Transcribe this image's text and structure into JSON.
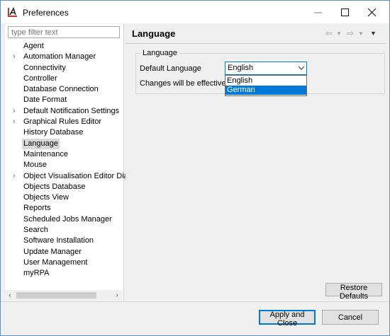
{
  "window": {
    "title": "Preferences",
    "accent": "#0078d7"
  },
  "sidebar": {
    "filter_placeholder": "type filter text",
    "items": [
      {
        "label": "Agent",
        "expandable": false,
        "selected": false
      },
      {
        "label": "Automation Manager",
        "expandable": true,
        "selected": false
      },
      {
        "label": "Connectivity",
        "expandable": false,
        "selected": false
      },
      {
        "label": "Controller",
        "expandable": false,
        "selected": false
      },
      {
        "label": "Database Connection",
        "expandable": false,
        "selected": false
      },
      {
        "label": "Date Format",
        "expandable": false,
        "selected": false
      },
      {
        "label": "Default Notification Settings",
        "expandable": true,
        "selected": false
      },
      {
        "label": "Graphical Rules Editor",
        "expandable": true,
        "selected": false
      },
      {
        "label": "History Database",
        "expandable": false,
        "selected": false
      },
      {
        "label": "Language",
        "expandable": false,
        "selected": true
      },
      {
        "label": "Maintenance",
        "expandable": false,
        "selected": false
      },
      {
        "label": "Mouse",
        "expandable": false,
        "selected": false
      },
      {
        "label": "Object Visualisation Editor Dia",
        "expandable": true,
        "selected": false
      },
      {
        "label": "Objects Database",
        "expandable": false,
        "selected": false
      },
      {
        "label": "Objects View",
        "expandable": false,
        "selected": false
      },
      {
        "label": "Reports",
        "expandable": false,
        "selected": false
      },
      {
        "label": "Scheduled Jobs Manager",
        "expandable": false,
        "selected": false
      },
      {
        "label": "Search",
        "expandable": false,
        "selected": false
      },
      {
        "label": "Software Installation",
        "expandable": false,
        "selected": false
      },
      {
        "label": "Update Manager",
        "expandable": false,
        "selected": false
      },
      {
        "label": "User Management",
        "expandable": false,
        "selected": false
      },
      {
        "label": "myRPA",
        "expandable": false,
        "selected": false
      }
    ]
  },
  "page": {
    "title": "Language",
    "group_title": "Language",
    "default_language_label": "Default Language",
    "note": "Changes will be effective a",
    "combo_value": "English",
    "dropdown_options": [
      "English",
      "German"
    ],
    "highlighted_option": "German",
    "restore_label": "Restore Defaults"
  },
  "footer": {
    "apply_label": "Apply and Close",
    "cancel_label": "Cancel"
  }
}
